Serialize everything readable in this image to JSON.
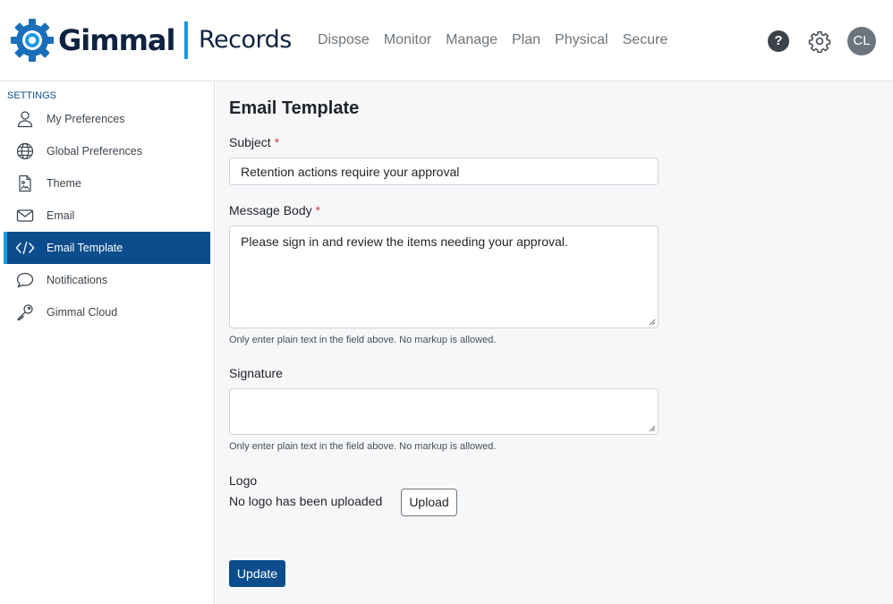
{
  "header": {
    "brand": "Gimmal",
    "app_name": "Records",
    "nav": [
      "Dispose",
      "Monitor",
      "Manage",
      "Plan",
      "Physical",
      "Secure"
    ],
    "help_label": "?",
    "avatar_initials": "CL"
  },
  "sidebar": {
    "heading": "SETTINGS",
    "items": [
      {
        "label": "My Preferences",
        "icon": "user-icon"
      },
      {
        "label": "Global Preferences",
        "icon": "globe-icon"
      },
      {
        "label": "Theme",
        "icon": "image-file-icon"
      },
      {
        "label": "Email",
        "icon": "envelope-icon"
      },
      {
        "label": "Email Template",
        "icon": "code-icon",
        "active": true
      },
      {
        "label": "Notifications",
        "icon": "chat-bubble-icon"
      },
      {
        "label": "Gimmal Cloud",
        "icon": "key-icon"
      }
    ]
  },
  "form": {
    "title": "Email Template",
    "subject_label": "Subject",
    "subject_value": "Retention actions require your approval",
    "body_label": "Message Body",
    "body_value": "Please sign in and review the items needing your approval.",
    "body_help": "Only enter plain text in the field above. No markup is allowed.",
    "signature_label": "Signature",
    "signature_value": "",
    "signature_help": "Only enter plain text in the field above. No markup is allowed.",
    "logo_label": "Logo",
    "logo_status": "No logo has been uploaded",
    "upload_label": "Upload",
    "update_label": "Update",
    "required_mark": "*"
  },
  "colors": {
    "primary": "#0b4d8c",
    "accent": "#1a9be0",
    "required": "#dc3545"
  }
}
